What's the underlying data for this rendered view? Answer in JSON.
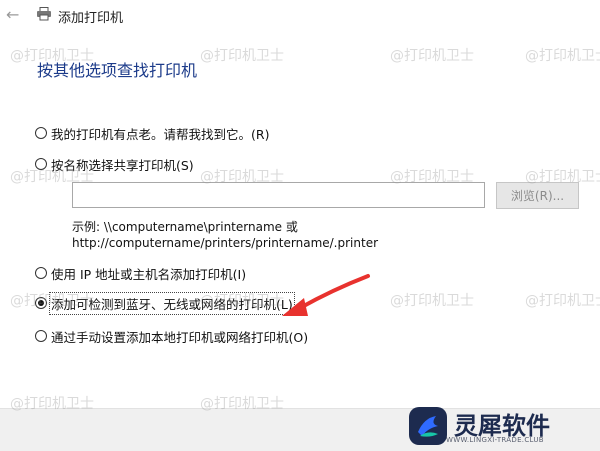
{
  "window": {
    "title": "添加打印机"
  },
  "heading": "按其他选项查找打印机",
  "options": [
    {
      "label": "我的打印机有点老。请帮我找到它。(R)",
      "checked": false
    },
    {
      "label": "按名称选择共享打印机(S)",
      "checked": false
    },
    {
      "label": "使用 IP 地址或主机名添加打印机(I)",
      "checked": false
    },
    {
      "label": "添加可检测到蓝牙、无线或网络的打印机(L)",
      "checked": true
    },
    {
      "label": "通过手动设置添加本地打印机或网络打印机(O)",
      "checked": false
    }
  ],
  "share": {
    "input_value": "",
    "browse_label": "浏览(R)..."
  },
  "example": {
    "line1": "示例: \\\\computername\\printername 或",
    "line2": "http://computername/printers/printername/.printer"
  },
  "watermark_text": "@打印机卫士",
  "brand": {
    "name": "灵犀软件",
    "sub": "WWW.LINGXI-TRADE.CLUB",
    "accent": "#2f6bff",
    "accent2": "#18c6a8"
  },
  "colors": {
    "heading": "#1c3b8a",
    "arrow": "#e8322e"
  }
}
